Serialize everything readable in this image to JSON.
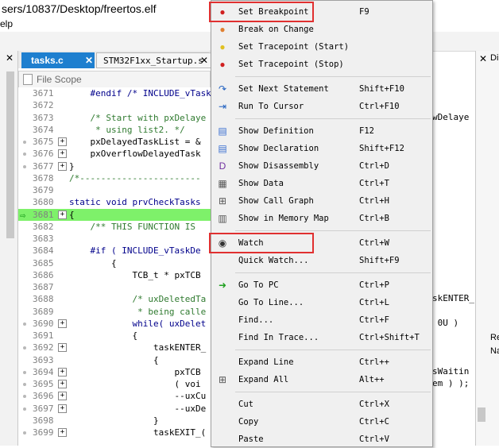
{
  "window": {
    "title": "sers/10837/Desktop/freertos.elf",
    "menu_fragment": "elp"
  },
  "left_pane": {
    "close": "✕"
  },
  "tabs": [
    {
      "label": "tasks.c",
      "close": "✕",
      "active": true
    },
    {
      "label": "STM32F1xx_Startup.s",
      "close": "✕",
      "active": false
    }
  ],
  "scope": {
    "label": "File Scope"
  },
  "code_lines": [
    {
      "num": "3671",
      "text": "    #endif /* INCLUDE_vTask",
      "kind": "kw",
      "expand": false,
      "bp": false
    },
    {
      "num": "3672",
      "text": "",
      "kind": "plain",
      "expand": false,
      "bp": false
    },
    {
      "num": "3673",
      "text": "    /* Start with pxDelaye",
      "kind": "cm",
      "expand": false,
      "bp": false
    },
    {
      "num": "3674",
      "text": "     * using list2. */",
      "kind": "cm",
      "expand": false,
      "bp": false
    },
    {
      "num": "3675",
      "text": "    pxDelayedTaskList = &",
      "kind": "plain",
      "expand": true,
      "bp": true
    },
    {
      "num": "3676",
      "text": "    pxOverflowDelayedTask",
      "kind": "plain",
      "expand": true,
      "bp": true
    },
    {
      "num": "3677",
      "text": "}",
      "kind": "plain",
      "expand": true,
      "bp": true
    },
    {
      "num": "3678",
      "text": "/*-----------------------",
      "kind": "cm",
      "expand": false,
      "bp": false
    },
    {
      "num": "3679",
      "text": "",
      "kind": "plain",
      "expand": false,
      "bp": false
    },
    {
      "num": "3680",
      "text": "static void prvCheckTasks",
      "kind": "kw",
      "expand": false,
      "bp": false
    },
    {
      "num": "3681",
      "text": "{",
      "kind": "hl",
      "expand": true,
      "bp": false
    },
    {
      "num": "3682",
      "text": "    /** THIS FUNCTION IS",
      "kind": "cm",
      "expand": false,
      "bp": false
    },
    {
      "num": "3683",
      "text": "",
      "kind": "plain",
      "expand": false,
      "bp": false
    },
    {
      "num": "3684",
      "text": "    #if ( INCLUDE_vTaskDe",
      "kind": "kw",
      "expand": false,
      "bp": false
    },
    {
      "num": "3685",
      "text": "        {",
      "kind": "plain",
      "expand": false,
      "bp": false
    },
    {
      "num": "3686",
      "text": "            TCB_t * pxTCB",
      "kind": "plain",
      "expand": false,
      "bp": false
    },
    {
      "num": "3687",
      "text": "",
      "kind": "plain",
      "expand": false,
      "bp": false
    },
    {
      "num": "3688",
      "text": "            /* uxDeletedTa",
      "kind": "cm",
      "expand": false,
      "bp": false
    },
    {
      "num": "3689",
      "text": "             * being calle",
      "kind": "cm",
      "expand": false,
      "bp": false
    },
    {
      "num": "3690",
      "text": "            while( uxDelet",
      "kind": "kw",
      "expand": true,
      "bp": true
    },
    {
      "num": "3691",
      "text": "            {",
      "kind": "plain",
      "expand": false,
      "bp": false
    },
    {
      "num": "3692",
      "text": "                taskENTER_",
      "kind": "plain",
      "expand": true,
      "bp": true
    },
    {
      "num": "3693",
      "text": "                {",
      "kind": "plain",
      "expand": false,
      "bp": false
    },
    {
      "num": "3694",
      "text": "                    pxTCB",
      "kind": "plain",
      "expand": true,
      "bp": true
    },
    {
      "num": "3695",
      "text": "                    ( voi",
      "kind": "plain",
      "expand": true,
      "bp": true
    },
    {
      "num": "3696",
      "text": "                    --uxCu",
      "kind": "plain",
      "expand": true,
      "bp": true
    },
    {
      "num": "3697",
      "text": "                    --uxDe",
      "kind": "plain",
      "expand": true,
      "bp": true
    },
    {
      "num": "3698",
      "text": "                }",
      "kind": "plain",
      "expand": false,
      "bp": false
    },
    {
      "num": "3699",
      "text": "                taskEXIT_(",
      "kind": "plain",
      "expand": true,
      "bp": true
    }
  ],
  "right_code": [
    {
      "row": 2,
      "text": "wDelaye"
    },
    {
      "row": 17,
      "text": "skENTER_"
    },
    {
      "row": 19,
      "text": " 0U )"
    },
    {
      "row": 23,
      "text": "sWaitin"
    },
    {
      "row": 24,
      "text": "em ) );"
    }
  ],
  "right_pane": {
    "close": "✕",
    "tab_fragment": "Di",
    "re_fragment": "Re",
    "na_fragment": "Na"
  },
  "context_menu": {
    "groups": [
      [
        {
          "label": "Set Breakpoint",
          "shortcut": "F9",
          "icon": "breakpoint-icon",
          "glyph": "●",
          "color": "#d02020",
          "highlight": true
        },
        {
          "label": "Break on Change",
          "shortcut": "",
          "icon": "break-on-change-icon",
          "glyph": "●",
          "color": "#e08030",
          "highlight": false
        },
        {
          "label": "Set Tracepoint (Start)",
          "shortcut": "",
          "icon": "tracepoint-start-icon",
          "glyph": "●",
          "color": "#e0c020",
          "highlight": false
        },
        {
          "label": "Set Tracepoint (Stop)",
          "shortcut": "",
          "icon": "tracepoint-stop-icon",
          "glyph": "●",
          "color": "#d02020",
          "highlight": false
        }
      ],
      [
        {
          "label": "Set Next Statement",
          "shortcut": "Shift+F10",
          "icon": "next-statement-icon",
          "glyph": "↷",
          "color": "#2060c0",
          "highlight": false
        },
        {
          "label": "Run To Cursor",
          "shortcut": "Ctrl+F10",
          "icon": "run-to-cursor-icon",
          "glyph": "⇥",
          "color": "#2060c0",
          "highlight": false
        }
      ],
      [
        {
          "label": "Show Definition",
          "shortcut": "F12",
          "icon": "definition-icon",
          "glyph": "▤",
          "color": "#3a6fd0",
          "highlight": false
        },
        {
          "label": "Show Declaration",
          "shortcut": "Shift+F12",
          "icon": "declaration-icon",
          "glyph": "▤",
          "color": "#3a6fd0",
          "highlight": false
        },
        {
          "label": "Show Disassembly",
          "shortcut": "Ctrl+D",
          "icon": "disassembly-icon",
          "glyph": "D",
          "color": "#7030a0",
          "highlight": false
        },
        {
          "label": "Show Data",
          "shortcut": "Ctrl+T",
          "icon": "data-icon",
          "glyph": "▦",
          "color": "#555555",
          "highlight": false
        },
        {
          "label": "Show Call Graph",
          "shortcut": "Ctrl+H",
          "icon": "call-graph-icon",
          "glyph": "⊞",
          "color": "#555555",
          "highlight": false
        },
        {
          "label": "Show in Memory Map",
          "shortcut": "Ctrl+B",
          "icon": "memory-map-icon",
          "glyph": "▥",
          "color": "#555555",
          "highlight": false
        }
      ],
      [
        {
          "label": "Watch",
          "shortcut": "Ctrl+W",
          "icon": "watch-icon",
          "glyph": "◉",
          "color": "#333333",
          "highlight": true
        },
        {
          "label": "Quick Watch...",
          "shortcut": "Shift+F9",
          "icon": "",
          "glyph": "",
          "color": "#000000",
          "highlight": false
        }
      ],
      [
        {
          "label": "Go To PC",
          "shortcut": "Ctrl+P",
          "icon": "go-to-pc-icon",
          "glyph": "➜",
          "color": "#20a020",
          "highlight": false
        },
        {
          "label": "Go To Line...",
          "shortcut": "Ctrl+L",
          "icon": "",
          "glyph": "",
          "color": "#000000",
          "highlight": false
        },
        {
          "label": "Find...",
          "shortcut": "Ctrl+F",
          "icon": "",
          "glyph": "",
          "color": "#000000",
          "highlight": false
        },
        {
          "label": "Find In Trace...",
          "shortcut": "Ctrl+Shift+T",
          "icon": "",
          "glyph": "",
          "color": "#000000",
          "highlight": false
        }
      ],
      [
        {
          "label": "Expand Line",
          "shortcut": "Ctrl++",
          "icon": "",
          "glyph": "",
          "color": "#000000",
          "highlight": false
        },
        {
          "label": "Expand All",
          "shortcut": "Alt++",
          "icon": "expand-all-icon",
          "glyph": "⊞",
          "color": "#555555",
          "highlight": false
        }
      ],
      [
        {
          "label": "Cut",
          "shortcut": "Ctrl+X",
          "icon": "",
          "glyph": "",
          "color": "#000000",
          "highlight": false
        },
        {
          "label": "Copy",
          "shortcut": "Ctrl+C",
          "icon": "",
          "glyph": "",
          "color": "#000000",
          "highlight": false
        },
        {
          "label": "Paste",
          "shortcut": "Ctrl+V",
          "icon": "",
          "glyph": "",
          "color": "#000000",
          "highlight": false
        }
      ]
    ]
  }
}
